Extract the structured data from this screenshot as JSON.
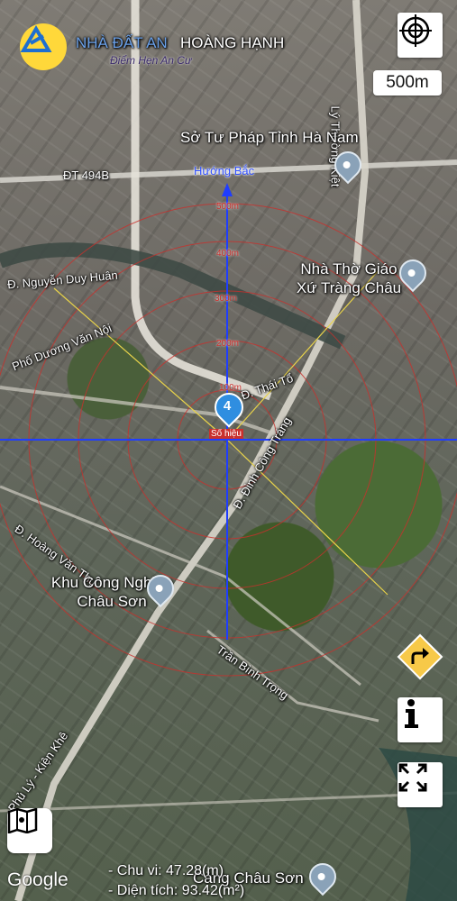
{
  "logo": {
    "brand": "NHÀ ĐẤT AN",
    "name": "HOÀNG HẠNH",
    "tagline": "Điểm Hẹn An Cư"
  },
  "scale": {
    "label": "500m"
  },
  "compass": {
    "label": "Hướng Bắc"
  },
  "roads": {
    "r1": "ĐT 494B",
    "r2": "Đ. Nguyễn Duy Huân",
    "r3": "Phố Dương Văn Nội",
    "r4": "Đ. Thái Tổ",
    "r5": "Đ. Đinh Công Tráng",
    "r6": "Đ. Hoàng Văn Thụ",
    "r7": "Trần Bình Trọng",
    "r8": "Phủ Lý - Kiện Khê",
    "r9": "Lý Thường Kiệt"
  },
  "pois": {
    "p1": "Sở Tư Pháp Tỉnh Hà Nam",
    "p2": "Nhà Thờ Giáo Xứ Tràng Châu",
    "p3": "Khu Công Nghiệp Châu Sơn",
    "p4": "Cảng Châu Sơn"
  },
  "rings": {
    "r500": "500m",
    "r400": "400m",
    "r300": "300m",
    "r200": "200m",
    "r100": "100m"
  },
  "marker": {
    "number": "4",
    "tag": "Số hiệu"
  },
  "info": {
    "perimeter": "- Chu vi: 47.28(m)",
    "area": "- Diện tích: 93.42(m²)"
  },
  "attribution": "Google",
  "colors": {
    "crosshair": "#1f3dff",
    "ring": "#c9302c",
    "marker": "#2f8ee0"
  },
  "icons": [
    "target-icon",
    "turn-right-icon",
    "info-icon",
    "fullscreen-icon",
    "map-type-icon"
  ]
}
